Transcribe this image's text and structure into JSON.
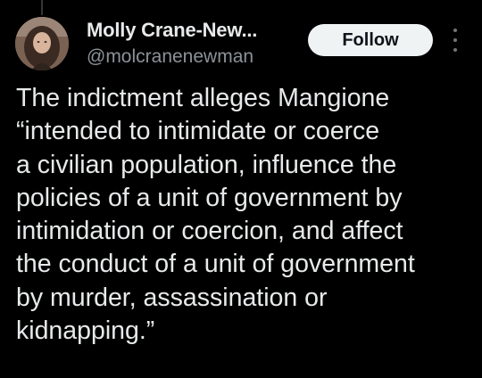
{
  "tweet": {
    "author": {
      "display_name": "Molly Crane-New...",
      "handle": "@molcranenewman"
    },
    "follow_label": "Follow",
    "more_icon": "more-vertical-icon",
    "text_lines": [
      "The indictment alleges Mangione",
      "“intended to intimidate or coerce",
      "a civilian population, influence the",
      "policies of a unit of government by",
      "intimidation or coercion, and affect",
      "the conduct of a unit of government",
      "by murder, assassination or",
      "kidnapping.”"
    ]
  },
  "colors": {
    "background": "#000000",
    "text_primary": "#e7e9ea",
    "text_secondary": "#8b9298",
    "button_bg": "#eff3f4",
    "button_text": "#0f1419"
  }
}
